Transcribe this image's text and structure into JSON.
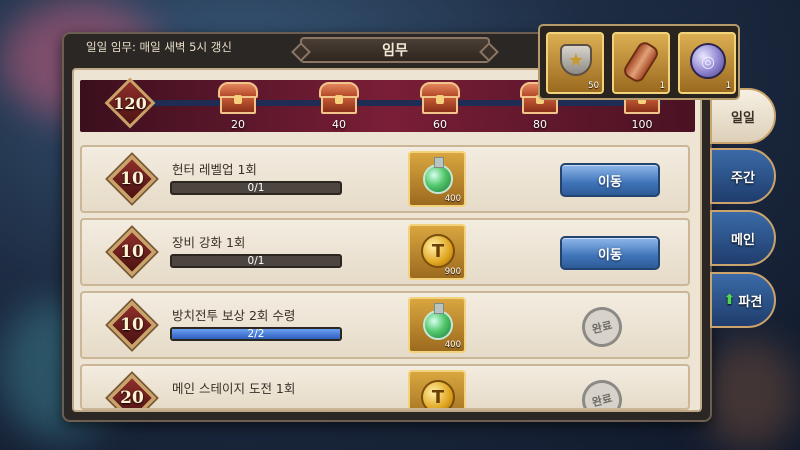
{
  "header": {
    "notice": "일일 임무: 매일 새벽 5시 갱신",
    "title": "임무"
  },
  "progress": {
    "level": "120",
    "fill_fraction": 0.0,
    "milestones": [
      "20",
      "40",
      "60",
      "80",
      "100"
    ]
  },
  "rewards_preview": [
    {
      "icon": "emblem-icon",
      "count": "50"
    },
    {
      "icon": "scroll-icon",
      "count": "1"
    },
    {
      "icon": "disc-icon",
      "count": "1"
    }
  ],
  "tabs": [
    {
      "label": "일일",
      "active": true
    },
    {
      "label": "주간",
      "active": false
    },
    {
      "label": "메인",
      "active": false
    },
    {
      "label": "파견",
      "active": false,
      "arrow": "⬆"
    }
  ],
  "missions": [
    {
      "points": "10",
      "name": "헌터 레벨업 1회",
      "progress": "0/1",
      "fill": 0.0,
      "reward_icon": "potion-icon",
      "reward_count": "400",
      "action": "이동",
      "state": "move"
    },
    {
      "points": "10",
      "name": "장비 강화 1회",
      "progress": "0/1",
      "fill": 0.0,
      "reward_icon": "coin-icon",
      "reward_count": "900",
      "action": "이동",
      "state": "move"
    },
    {
      "points": "10",
      "name": "방치전투 보상 2회 수령",
      "progress": "2/2",
      "fill": 1.0,
      "reward_icon": "potion-icon",
      "reward_count": "400",
      "action": "완료",
      "state": "done"
    },
    {
      "points": "20",
      "name": "메인 스테이지 도전 1회",
      "progress": "",
      "fill": 1.0,
      "reward_icon": "coin-icon",
      "reward_count": "",
      "action": "완료",
      "state": "done"
    }
  ],
  "colors": {
    "panel": "#2b2724",
    "row_bg": "#ede4d3",
    "button_blue": "#3f73b8",
    "strip_red": "#7a1e37"
  }
}
